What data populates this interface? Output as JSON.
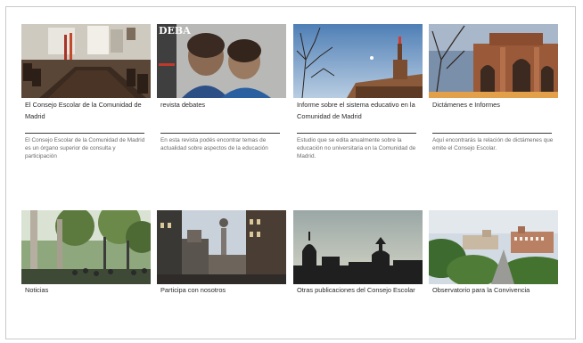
{
  "cards": [
    {
      "title": "El Consejo Escolar de la Comunidad de Madrid",
      "description": "El Consejo Escolar de la Comunidad de Madrid es un órgano superior de consulta y participación"
    },
    {
      "title": "revista debates",
      "description": "En esta revista podés encontrar temas de actualidad sobre aspectos de la educación",
      "image_text": "DEBA"
    },
    {
      "title": "Informe sobre el sistema educativo en la Comunidad de Madrid",
      "description": "Estudio que se edita anualmente sobre la educación no universitaria en la Comunidad de Madrid."
    },
    {
      "title": "Dictámenes e Informes",
      "description": "Aquí encontrarás la relación de dictámenes que emite el Consejo Escolar."
    },
    {
      "title": "Noticias"
    },
    {
      "title": "Participa con nosotros"
    },
    {
      "title": "Otras publicaciones del Consejo Escolar"
    },
    {
      "title": "Observatorio para la Convivencia"
    }
  ]
}
